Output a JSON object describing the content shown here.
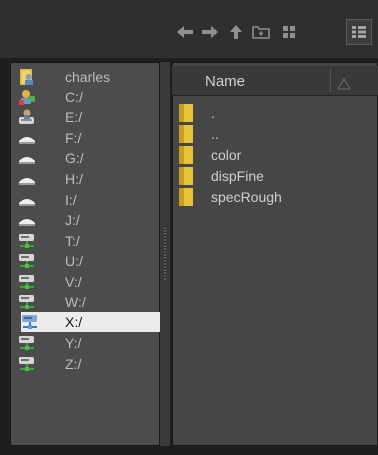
{
  "toolbar": {
    "buttons": [
      {
        "name": "back",
        "icon": "arrow-left-icon"
      },
      {
        "name": "forward",
        "icon": "arrow-right-icon"
      },
      {
        "name": "up",
        "icon": "arrow-up-icon"
      },
      {
        "name": "new-folder",
        "icon": "new-folder-icon"
      },
      {
        "name": "icon-view",
        "icon": "grid-view-icon"
      },
      {
        "name": "detail-view",
        "icon": "list-view-icon",
        "selected": true
      }
    ]
  },
  "sidebar": {
    "items": [
      {
        "label": "charles",
        "icon": "home-user-icon"
      },
      {
        "label": "C:/",
        "icon": "system-drive-icon"
      },
      {
        "label": "E:/",
        "icon": "disk-user-icon"
      },
      {
        "label": "F:/",
        "icon": "removable-drive-icon"
      },
      {
        "label": "G:/",
        "icon": "removable-drive-icon"
      },
      {
        "label": "H:/",
        "icon": "removable-drive-icon"
      },
      {
        "label": "I:/",
        "icon": "removable-drive-icon"
      },
      {
        "label": "J:/",
        "icon": "removable-drive-icon"
      },
      {
        "label": "T:/",
        "icon": "network-drive-icon"
      },
      {
        "label": "U:/",
        "icon": "network-drive-icon"
      },
      {
        "label": "V:/",
        "icon": "network-drive-icon"
      },
      {
        "label": "W:/",
        "icon": "network-drive-icon"
      },
      {
        "label": "X:/",
        "icon": "network-drive-icon",
        "selected": true
      },
      {
        "label": "Y:/",
        "icon": "network-drive-icon"
      },
      {
        "label": "Z:/",
        "icon": "network-drive-icon"
      }
    ]
  },
  "file_list": {
    "header": {
      "name": "Name",
      "sort_icon": "sort-triangle-icon"
    },
    "files": [
      {
        "label": "."
      },
      {
        "label": ".."
      },
      {
        "label": "color"
      },
      {
        "label": "dispFine"
      },
      {
        "label": "specRough"
      }
    ]
  },
  "colors": {
    "folder": "#e8c23a",
    "selected_bg": "#ececec",
    "sidebar_bg": "#4c4c4c",
    "panel_bg": "#464646"
  }
}
